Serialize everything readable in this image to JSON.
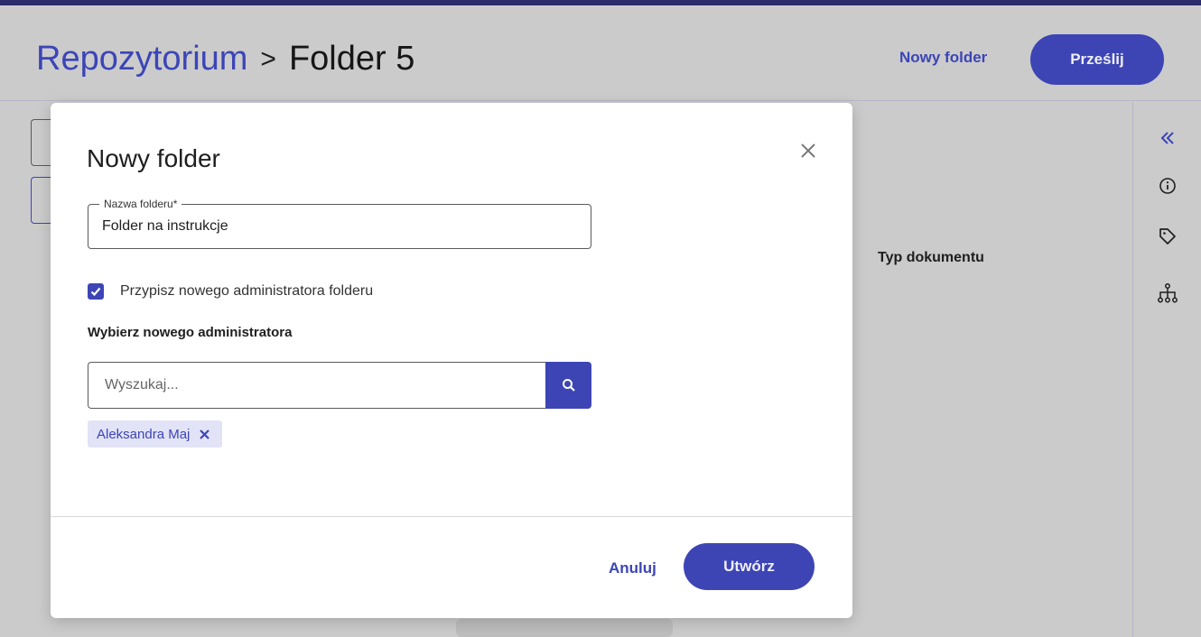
{
  "header": {
    "breadcrumb_root": "Repozytorium",
    "breadcrumb_separator": ">",
    "breadcrumb_current": "Folder 5",
    "new_folder_link": "Nowy folder",
    "upload_button": "Prześlij"
  },
  "background": {
    "column_label": "Typ dokumentu"
  },
  "right_rail": {
    "icons": [
      "collapse-double-chevron-icon",
      "info-icon",
      "tag-icon",
      "hierarchy-icon"
    ]
  },
  "modal": {
    "title": "Nowy folder",
    "folder_name_label": "Nazwa folderu*",
    "folder_name_value": "Folder na instrukcje",
    "assign_admin_checkbox": {
      "label": "Przypisz nowego administratora folderu",
      "checked": true
    },
    "choose_admin_label": "Wybierz nowego administratora",
    "search_placeholder": "Wyszukaj...",
    "selected_admins": [
      "Aleksandra Maj"
    ],
    "cancel_label": "Anuluj",
    "create_label": "Utwórz"
  },
  "colors": {
    "accent": "#3d45b5",
    "accent_text": "#3c45b7",
    "chip_bg": "#e2e3f7",
    "overlay_bg": "#cbcbcb",
    "top_strip": "#2a2c6e"
  }
}
